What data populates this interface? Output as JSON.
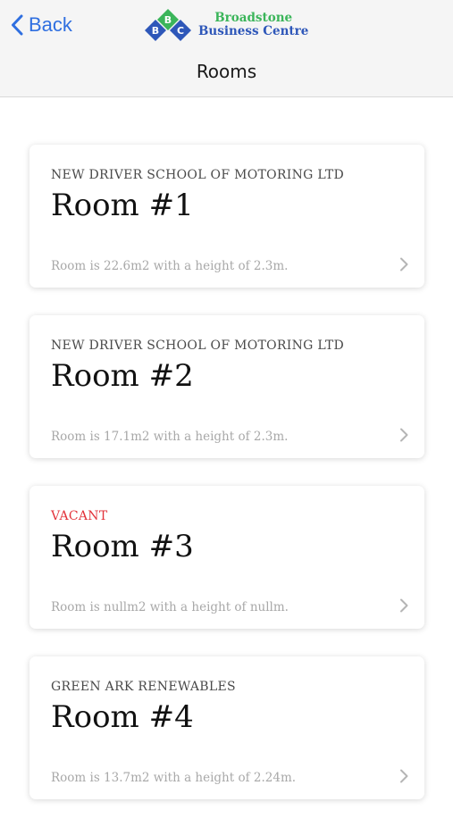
{
  "nav": {
    "back_label": "Back",
    "logo": {
      "initials": [
        "B",
        "B",
        "C"
      ],
      "line1": "Broadstone",
      "line2": "Business Centre"
    },
    "title": "Rooms"
  },
  "colors": {
    "accent": "#2f6fe0",
    "logo_green": "#3bb55a",
    "logo_blue": "#2e57b9",
    "vacant": "#e2323a"
  },
  "rooms": [
    {
      "tenant": "NEW DRIVER SCHOOL OF MOTORING LTD",
      "name": "Room #1",
      "description": "Room is 22.6m2 with a height of 2.3m.",
      "vacant": false
    },
    {
      "tenant": "NEW DRIVER SCHOOL OF MOTORING LTD",
      "name": "Room #2",
      "description": "Room is 17.1m2 with a height of 2.3m.",
      "vacant": false
    },
    {
      "tenant": "VACANT",
      "name": "Room #3",
      "description": "Room is nullm2 with a height of nullm.",
      "vacant": true
    },
    {
      "tenant": "GREEN ARK RENEWABLES",
      "name": "Room #4",
      "description": "Room is 13.7m2 with a height of 2.24m.",
      "vacant": false
    }
  ]
}
